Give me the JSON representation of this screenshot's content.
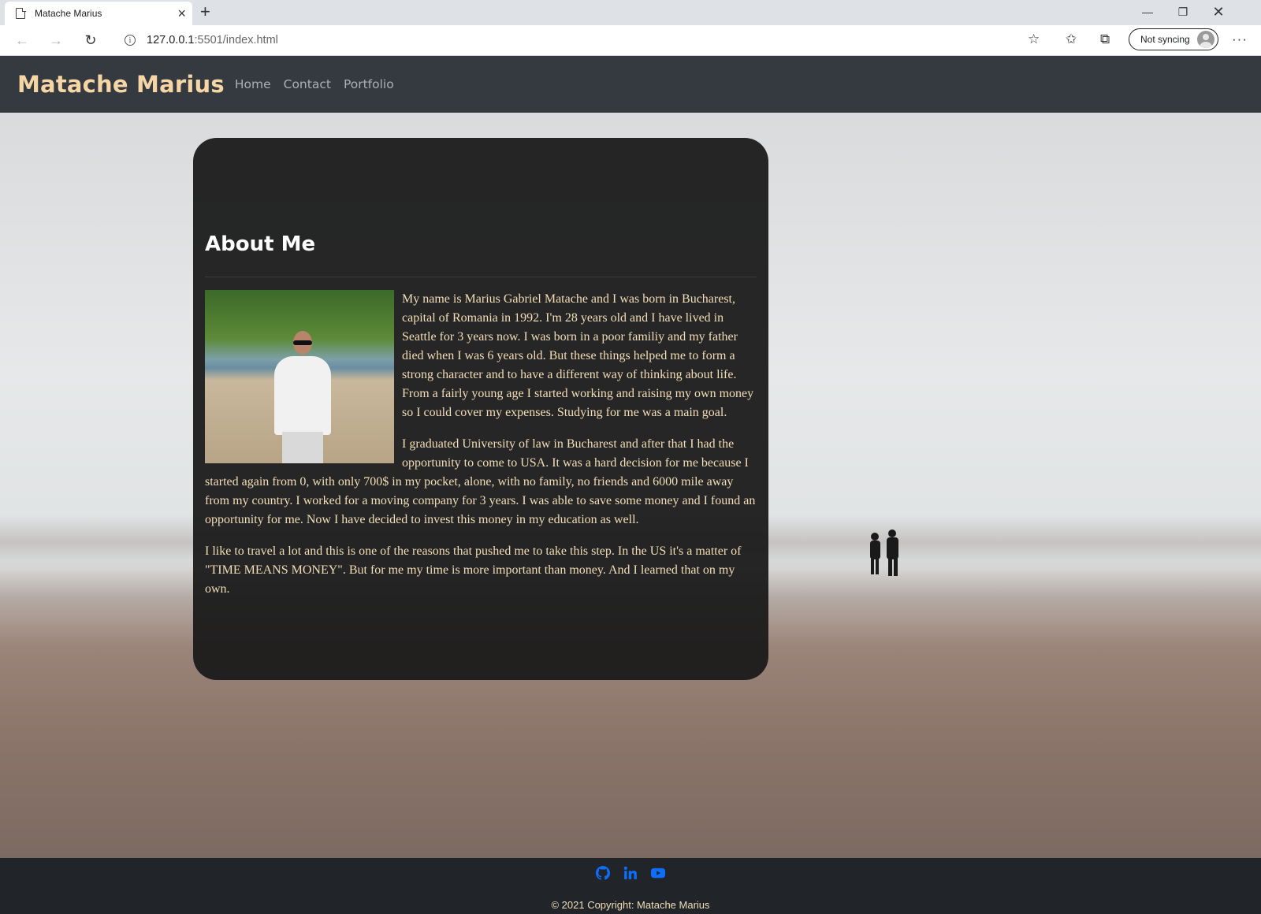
{
  "browser": {
    "tab_title": "Matache Marius",
    "url_host": "127.0.0.1",
    "url_path": ":5501/index.html",
    "sync_label": "Not syncing"
  },
  "site": {
    "brand": "Matache Marius",
    "nav": [
      {
        "label": "Home"
      },
      {
        "label": "Contact"
      },
      {
        "label": "Portfolio"
      }
    ]
  },
  "about": {
    "title": "About Me",
    "paragraphs": [
      "My name is Marius Gabriel Matache and I was born in Bucharest, capital of Romania in 1992. I'm 28 years old and I have lived in Seattle for 3 years now. I was born in a poor familiy and my father died when I was 6 years old. But these things helped me to form a strong character and to have a different way of thinking about life. From a fairly young age I started working and raising my own money so I could cover my expenses. Studying for me was a main goal.",
      "I graduated University of law in Bucharest and after that I had the opportunity to come to USA. It was a hard decision for me because I started again from 0, with only 700$ in my pocket, alone, with no family, no friends and 6000 mile away from my country. I worked for a moving company for 3 years. I was able to save some money and I found an opportunity for me. Now I have decided to invest this money in my education as well.",
      "I like to travel a lot and this is one of the reasons that pushed me to take this step. In the US it's a matter of \"TIME MEANS MONEY\". But for me my time is more important than money. And I learned that on my own."
    ]
  },
  "footer": {
    "social_icons": [
      "github-icon",
      "linkedin-icon",
      "youtube-icon"
    ],
    "copyright": "© 2021 Copyright: Matache Marius"
  },
  "colors": {
    "nav_bg": "#343a40",
    "brand": "#f6d6a4",
    "text_cream": "#f3deb8",
    "footer_bg": "#212529",
    "social_blue": "#0d6efd"
  }
}
